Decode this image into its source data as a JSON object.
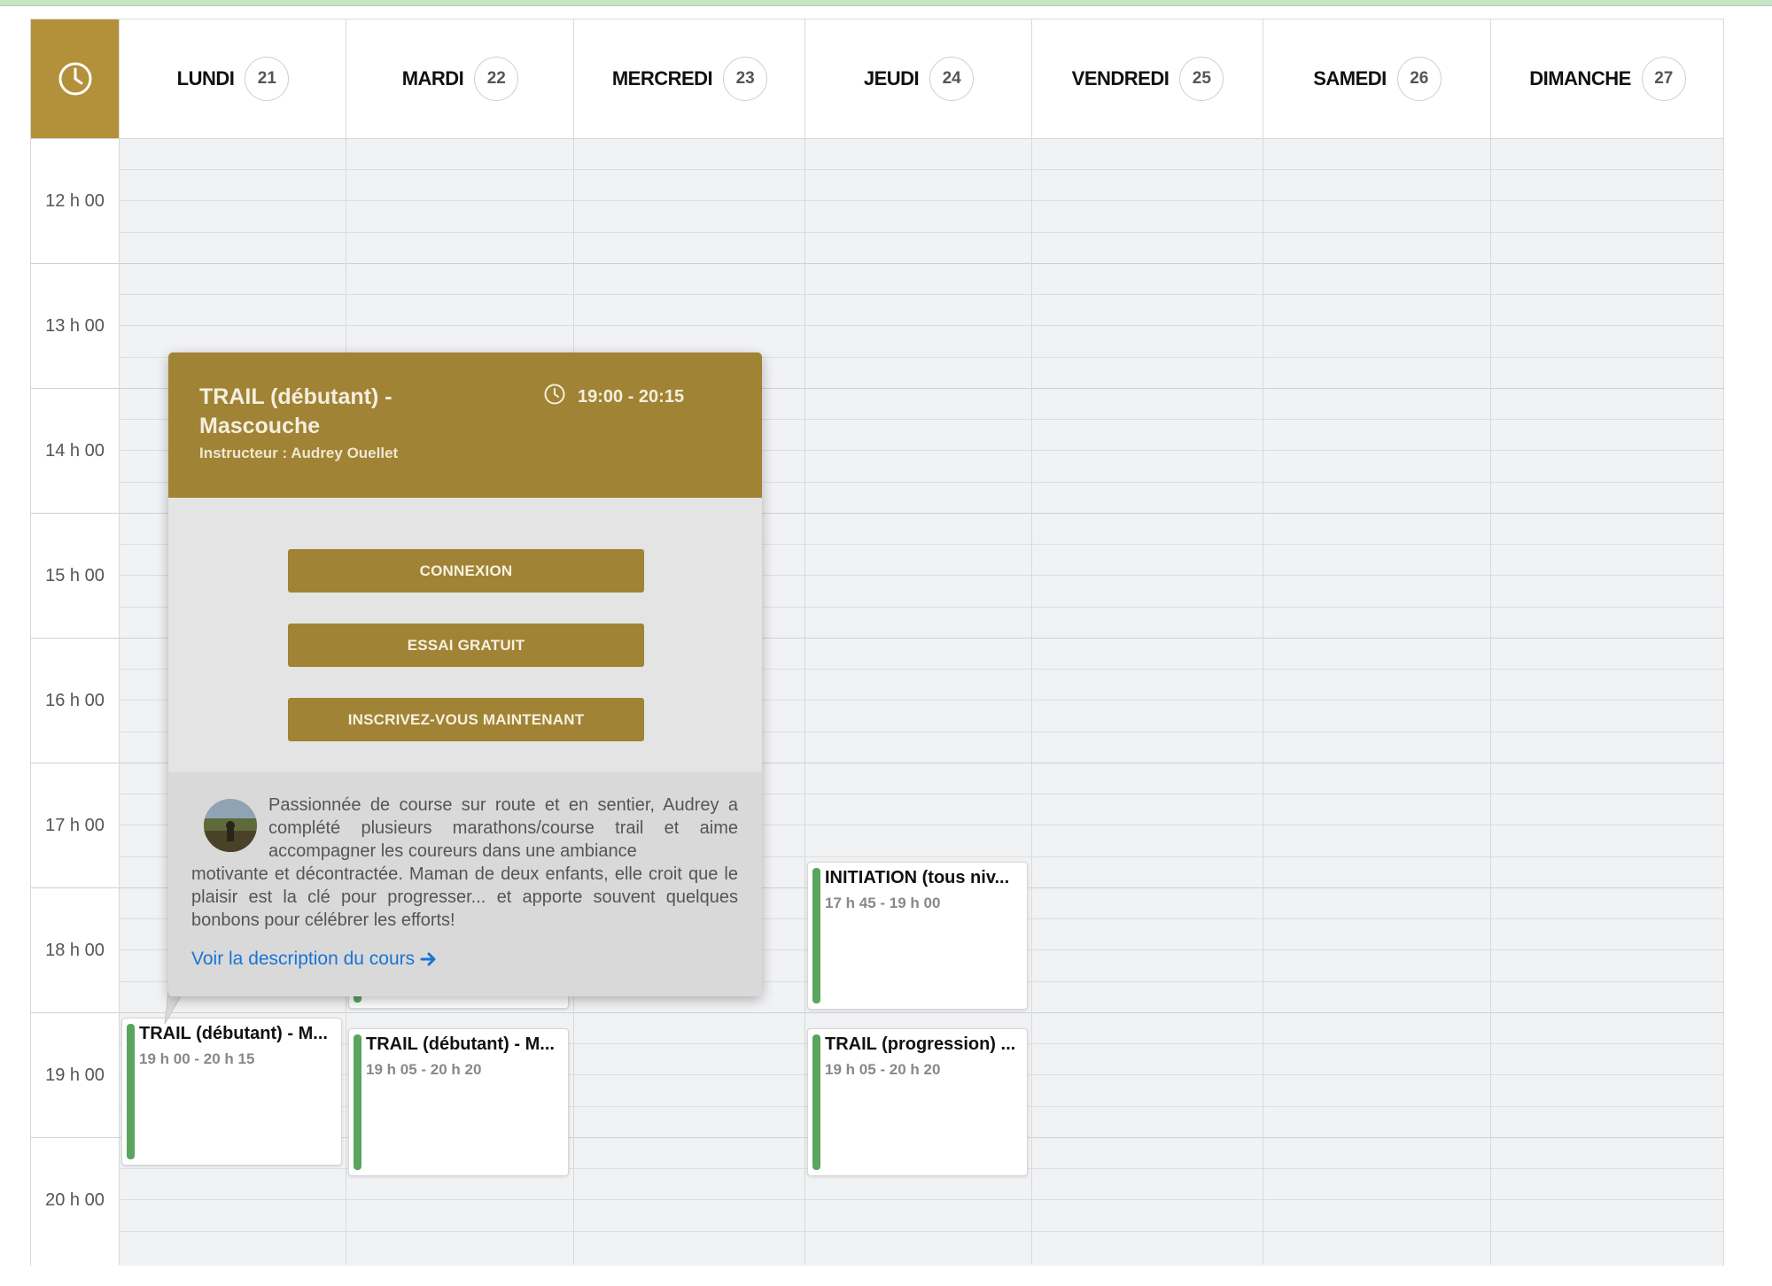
{
  "days": [
    {
      "name": "LUNDI",
      "num": "21"
    },
    {
      "name": "MARDI",
      "num": "22"
    },
    {
      "name": "MERCREDI",
      "num": "23"
    },
    {
      "name": "JEUDI",
      "num": "24"
    },
    {
      "name": "VENDREDI",
      "num": "25"
    },
    {
      "name": "SAMEDI",
      "num": "26"
    },
    {
      "name": "DIMANCHE",
      "num": "27"
    }
  ],
  "time_slots": [
    "12 h 00",
    "13 h 00",
    "14 h 00",
    "15 h 00",
    "16 h 00",
    "17 h 00",
    "18 h 00",
    "19 h 00",
    "20 h 00"
  ],
  "events": [
    {
      "title": "TRAIL (débutant) - M...",
      "time": "19 h 00 - 20 h 15"
    },
    {
      "title": "TRAIL (débutant) - M...",
      "time": "19 h 05 - 20 h 20"
    },
    {
      "title": "INITIATION (tous niv...",
      "time": "17 h 45 - 19 h 00"
    },
    {
      "title": "TRAIL (progression) ...",
      "time": "19 h 05 - 20 h 20"
    }
  ],
  "popup": {
    "title": "TRAIL (débutant) - Mascouche",
    "instructor": "Instructeur : Audrey Ouellet",
    "time": "19:00 - 20:15",
    "buttons": [
      "CONNEXION",
      "ESSAI GRATUIT",
      "INSCRIVEZ-VOUS MAINTENANT"
    ],
    "description_first": "Passionnée de course sur route et en sentier, Audrey a complété plusieurs marathons/course trail et aime accompagner les coureurs dans une ambiance",
    "description_rest": "motivante et décontractée. Maman de deux enfants, elle croit que le plaisir est la clé pour progresser... et apporte souvent quelques bonbons pour célébrer les efforts!",
    "link": "Voir la description du cours",
    "link_icon": "arrow-right-icon"
  },
  "colors": {
    "accent": "#a08334",
    "clock_bg": "#b3913a",
    "event_bar": "#5aa55e",
    "link": "#1a74d6"
  }
}
